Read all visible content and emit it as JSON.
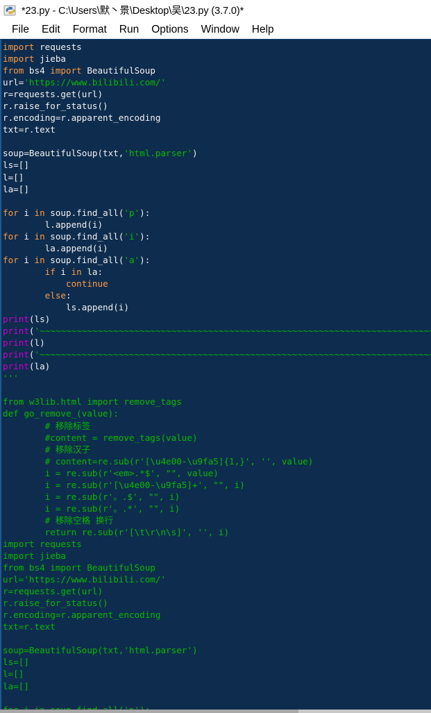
{
  "window": {
    "title": "*23.py - C:\\Users\\默丶景\\Desktop\\吴\\23.py (3.7.0)*",
    "icon": "python-idle-icon"
  },
  "menubar": {
    "items": [
      {
        "label": "File"
      },
      {
        "label": "Edit"
      },
      {
        "label": "Format"
      },
      {
        "label": "Run"
      },
      {
        "label": "Options"
      },
      {
        "label": "Window"
      },
      {
        "label": "Help"
      }
    ]
  },
  "colors": {
    "editor_background": "#0d2c4e",
    "keyword": "#ff9b44",
    "string": "#00bb00",
    "builtin": "#cc00cc",
    "plain": "#f2f2f2",
    "chrome_background": "#ffffff"
  },
  "editor": {
    "lines": [
      {
        "segments": [
          {
            "t": "import",
            "c": "kw"
          },
          {
            "t": " requests",
            "c": "pl"
          }
        ]
      },
      {
        "segments": [
          {
            "t": "import",
            "c": "kw"
          },
          {
            "t": " jieba",
            "c": "pl"
          }
        ]
      },
      {
        "segments": [
          {
            "t": "from",
            "c": "kw"
          },
          {
            "t": " bs4 ",
            "c": "pl"
          },
          {
            "t": "import",
            "c": "kw"
          },
          {
            "t": " BeautifulSoup",
            "c": "pl"
          }
        ]
      },
      {
        "segments": [
          {
            "t": "url=",
            "c": "pl"
          },
          {
            "t": "'https://www.bilibili.com/'",
            "c": "str"
          }
        ]
      },
      {
        "segments": [
          {
            "t": "r=requests.get(url)",
            "c": "pl"
          }
        ]
      },
      {
        "segments": [
          {
            "t": "r.raise_for_status()",
            "c": "pl"
          }
        ]
      },
      {
        "segments": [
          {
            "t": "r.encoding=r.apparent_encoding",
            "c": "pl"
          }
        ]
      },
      {
        "segments": [
          {
            "t": "txt=r.text",
            "c": "pl"
          }
        ]
      },
      {
        "segments": []
      },
      {
        "segments": [
          {
            "t": "soup=BeautifulSoup(txt,",
            "c": "pl"
          },
          {
            "t": "'html.parser'",
            "c": "str"
          },
          {
            "t": ")",
            "c": "pl"
          }
        ]
      },
      {
        "segments": [
          {
            "t": "ls=[]",
            "c": "pl"
          }
        ]
      },
      {
        "segments": [
          {
            "t": "l=[]",
            "c": "pl"
          }
        ]
      },
      {
        "segments": [
          {
            "t": "la=[]",
            "c": "pl"
          }
        ]
      },
      {
        "segments": []
      },
      {
        "segments": [
          {
            "t": "for",
            "c": "kw"
          },
          {
            "t": " i ",
            "c": "pl"
          },
          {
            "t": "in",
            "c": "kw"
          },
          {
            "t": " soup.find_all(",
            "c": "pl"
          },
          {
            "t": "'p'",
            "c": "str"
          },
          {
            "t": "):",
            "c": "pl"
          }
        ]
      },
      {
        "segments": [
          {
            "t": "        l.append(i)",
            "c": "pl"
          }
        ]
      },
      {
        "segments": [
          {
            "t": "for",
            "c": "kw"
          },
          {
            "t": " i ",
            "c": "pl"
          },
          {
            "t": "in",
            "c": "kw"
          },
          {
            "t": " soup.find_all(",
            "c": "pl"
          },
          {
            "t": "'i'",
            "c": "str"
          },
          {
            "t": "):",
            "c": "pl"
          }
        ]
      },
      {
        "segments": [
          {
            "t": "        la.append(i)",
            "c": "pl"
          }
        ]
      },
      {
        "segments": [
          {
            "t": "for",
            "c": "kw"
          },
          {
            "t": " i ",
            "c": "pl"
          },
          {
            "t": "in",
            "c": "kw"
          },
          {
            "t": " soup.find_all(",
            "c": "pl"
          },
          {
            "t": "'a'",
            "c": "str"
          },
          {
            "t": "):",
            "c": "pl"
          }
        ]
      },
      {
        "segments": [
          {
            "t": "        ",
            "c": "pl"
          },
          {
            "t": "if",
            "c": "kw"
          },
          {
            "t": " i ",
            "c": "pl"
          },
          {
            "t": "in",
            "c": "kw"
          },
          {
            "t": " la:",
            "c": "pl"
          }
        ]
      },
      {
        "segments": [
          {
            "t": "            ",
            "c": "pl"
          },
          {
            "t": "continue",
            "c": "kw"
          }
        ]
      },
      {
        "segments": [
          {
            "t": "        ",
            "c": "pl"
          },
          {
            "t": "else",
            "c": "kw"
          },
          {
            "t": ":",
            "c": "pl"
          }
        ]
      },
      {
        "segments": [
          {
            "t": "            ls.append(i)",
            "c": "pl"
          }
        ]
      },
      {
        "segments": [
          {
            "t": "print",
            "c": "bi"
          },
          {
            "t": "(ls)",
            "c": "pl"
          }
        ]
      },
      {
        "segments": [
          {
            "t": "print",
            "c": "bi"
          },
          {
            "t": "(",
            "c": "pl"
          },
          {
            "t": "'~~~~~~~~~~~~~~~~~~~~~~~~~~~~~~~~~~~~~~~~~~~~~~~~~~~~~~~~~~~~~~~~~~~~~~~~~~~~~~~~~~'",
            "c": "str"
          },
          {
            "t": ")",
            "c": "pl"
          }
        ]
      },
      {
        "segments": [
          {
            "t": "print",
            "c": "bi"
          },
          {
            "t": "(l)",
            "c": "pl"
          }
        ]
      },
      {
        "segments": [
          {
            "t": "print",
            "c": "bi"
          },
          {
            "t": "(",
            "c": "pl"
          },
          {
            "t": "'~~~~~~~~~~~~~~~~~~~~~~~~~~~~~~~~~~~~~~~~~~~~~~~~~~~~~~~~~~~~~~~~~~~~~~~~~~~~~~~~~~'",
            "c": "str"
          },
          {
            "t": ")",
            "c": "pl"
          }
        ]
      },
      {
        "segments": [
          {
            "t": "print",
            "c": "bi"
          },
          {
            "t": "(la)",
            "c": "pl"
          }
        ]
      },
      {
        "segments": [
          {
            "t": "'''",
            "c": "gr"
          }
        ]
      },
      {
        "segments": []
      },
      {
        "segments": [
          {
            "t": "from w3lib.html import remove_tags",
            "c": "gr"
          }
        ]
      },
      {
        "segments": [
          {
            "t": "def go_remove_(value):",
            "c": "gr"
          }
        ]
      },
      {
        "segments": [
          {
            "t": "        # 移除标签",
            "c": "gr"
          }
        ]
      },
      {
        "segments": [
          {
            "t": "        #content = remove_tags(value)",
            "c": "gr"
          }
        ]
      },
      {
        "segments": [
          {
            "t": "        # 移除汉子",
            "c": "gr"
          }
        ]
      },
      {
        "segments": [
          {
            "t": "        # content=re.sub(r'[\\u4e00-\\u9fa5]{1,}', '', value)",
            "c": "gr"
          }
        ]
      },
      {
        "segments": [
          {
            "t": "        i = re.sub(r'<em>.*$', \"\", value)",
            "c": "gr"
          }
        ]
      },
      {
        "segments": [
          {
            "t": "        i = re.sub(r'[\\u4e00-\\u9fa5]+', \"\", i)",
            "c": "gr"
          }
        ]
      },
      {
        "segments": [
          {
            "t": "        i = re.sub(r'。.$', \"\", i)",
            "c": "gr"
          }
        ]
      },
      {
        "segments": [
          {
            "t": "        i = re.sub(r'。.*', \"\", i)",
            "c": "gr"
          }
        ]
      },
      {
        "segments": [
          {
            "t": "        # 移除空格 换行",
            "c": "gr"
          }
        ]
      },
      {
        "segments": [
          {
            "t": "        return re.sub(r'[\\t\\r\\n\\s]', '', i)",
            "c": "gr"
          }
        ]
      },
      {
        "segments": [
          {
            "t": "import requests",
            "c": "gr"
          }
        ]
      },
      {
        "segments": [
          {
            "t": "import jieba",
            "c": "gr"
          }
        ]
      },
      {
        "segments": [
          {
            "t": "from bs4 import BeautifulSoup",
            "c": "gr"
          }
        ]
      },
      {
        "segments": [
          {
            "t": "url='https://www.bilibili.com/'",
            "c": "gr"
          }
        ]
      },
      {
        "segments": [
          {
            "t": "r=requests.get(url)",
            "c": "gr"
          }
        ]
      },
      {
        "segments": [
          {
            "t": "r.raise_for_status()",
            "c": "gr"
          }
        ]
      },
      {
        "segments": [
          {
            "t": "r.encoding=r.apparent_encoding",
            "c": "gr"
          }
        ]
      },
      {
        "segments": [
          {
            "t": "txt=r.text",
            "c": "gr"
          }
        ]
      },
      {
        "segments": []
      },
      {
        "segments": [
          {
            "t": "soup=BeautifulSoup(txt,'html.parser')",
            "c": "gr"
          }
        ]
      },
      {
        "segments": [
          {
            "t": "ls=[]",
            "c": "gr"
          }
        ]
      },
      {
        "segments": [
          {
            "t": "l=[]",
            "c": "gr"
          }
        ]
      },
      {
        "segments": [
          {
            "t": "la=[]",
            "c": "gr"
          }
        ]
      },
      {
        "segments": []
      },
      {
        "segments": [
          {
            "t": "for i in soup.find_all('p'):",
            "c": "gr"
          }
        ]
      }
    ]
  }
}
